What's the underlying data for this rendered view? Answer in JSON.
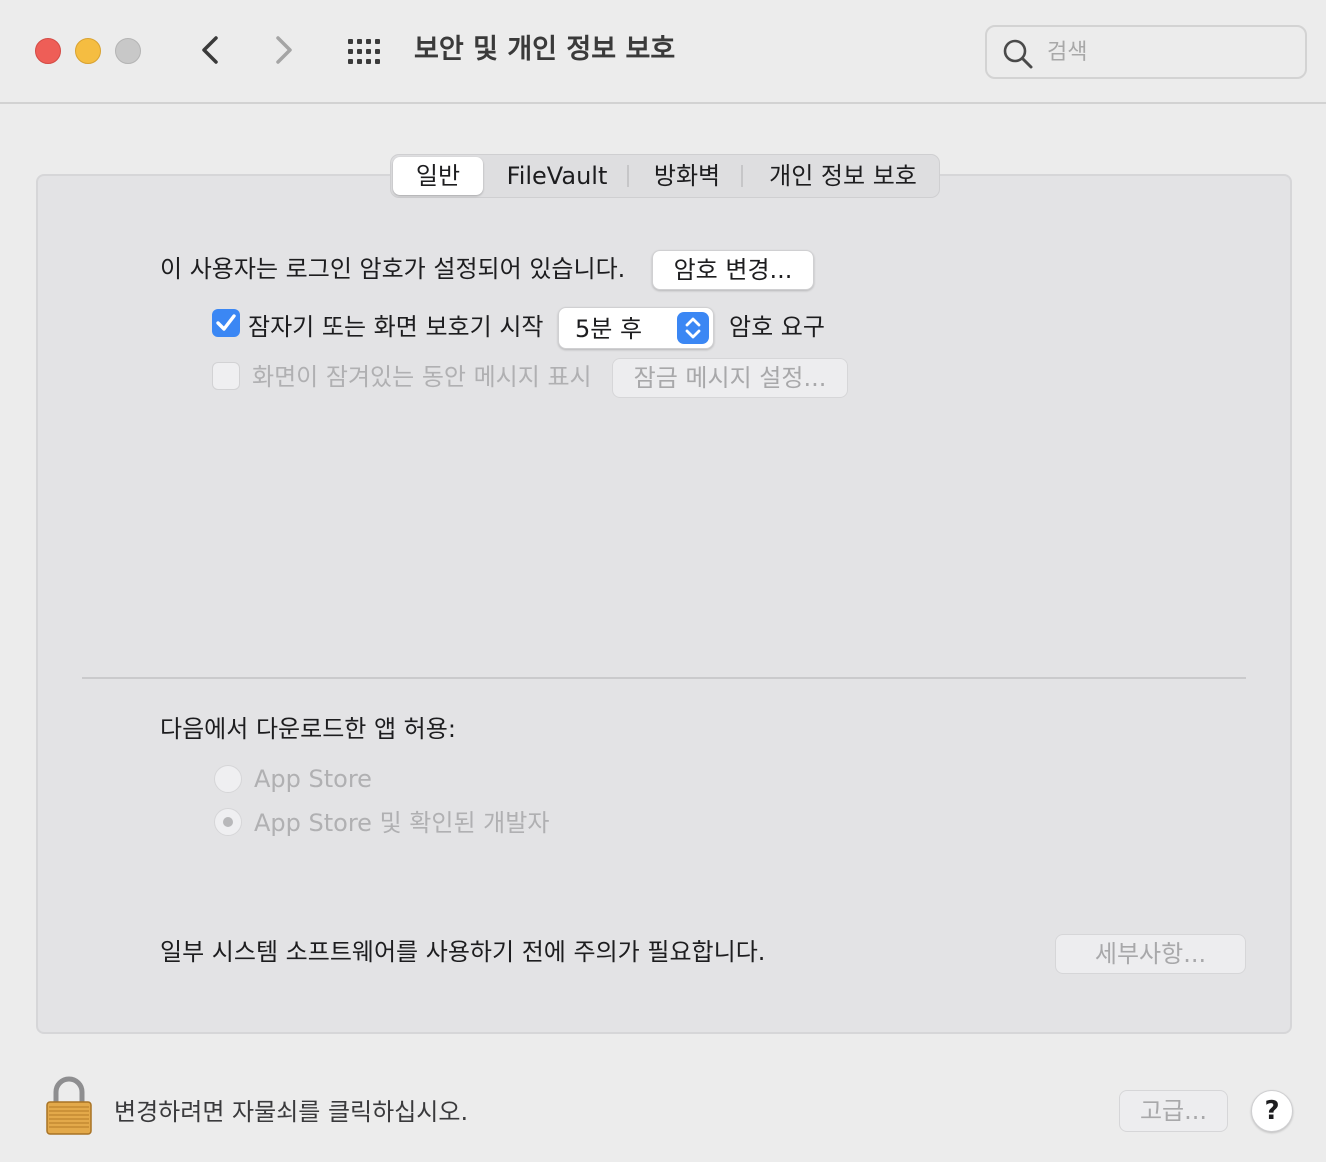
{
  "window": {
    "title": "보안 및 개인 정보 보호",
    "search_placeholder": "검색"
  },
  "tabs": [
    {
      "label": "일반",
      "selected": true
    },
    {
      "label": "FileVault",
      "selected": false
    },
    {
      "label": "방화벽",
      "selected": false
    },
    {
      "label": "개인 정보 보호",
      "selected": false
    }
  ],
  "general": {
    "password_set_text": "이 사용자는 로그인 암호가 설정되어 있습니다.",
    "change_password_button": "암호 변경...",
    "require_password": {
      "checked": true,
      "label_before": "잠자기 또는 화면 보호기 시작",
      "selected_delay": "5분 후",
      "label_after": "암호 요구"
    },
    "lock_message": {
      "checked": false,
      "enabled": false,
      "label": "화면이 잠겨있는 동안 메시지 표시",
      "button": "잠금 메시지 설정..."
    },
    "allow_apps": {
      "heading": "다음에서 다운로드한 앱 허용:",
      "options": [
        {
          "label": "App Store",
          "selected": false
        },
        {
          "label": "App Store 및 확인된 개발자",
          "selected": true
        }
      ]
    },
    "system_software": {
      "text": "일부 시스템 소프트웨어를 사용하기 전에 주의가 필요합니다.",
      "details_button": "세부사항..."
    }
  },
  "footer": {
    "lock_text": "변경하려면 자물쇠를 클릭하십시오.",
    "advanced_button": "고급...",
    "help_label": "?"
  },
  "colors": {
    "accent": "#3b87f4",
    "close": "#ee5e57",
    "minimize": "#f5bd41",
    "maximize": "#c8c8c8"
  },
  "icons": [
    "close-icon",
    "minimize-icon",
    "zoom-icon",
    "back-icon",
    "forward-icon",
    "show-all-icon",
    "search-icon",
    "checkmark-icon",
    "popup-arrows-icon",
    "lock-icon",
    "help-icon"
  ]
}
